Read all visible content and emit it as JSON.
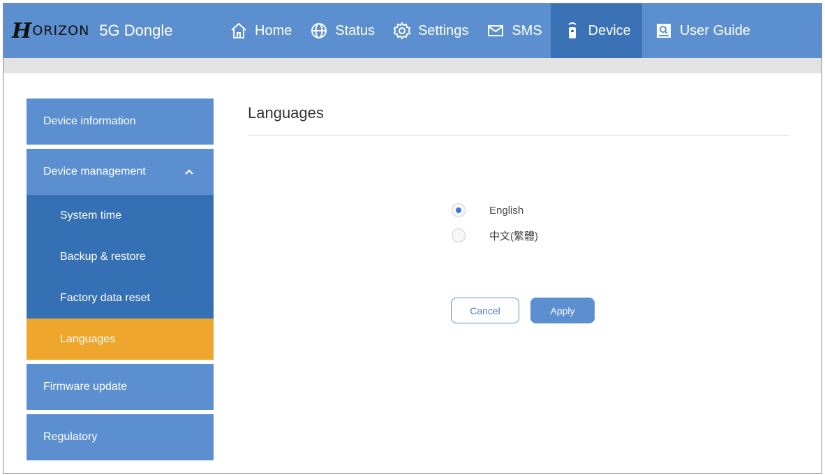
{
  "brand": {
    "logo": "H",
    "name": "ORIZON",
    "product": "5G Dongle"
  },
  "nav": [
    {
      "label": "Home",
      "icon": "home-icon"
    },
    {
      "label": "Status",
      "icon": "globe-icon"
    },
    {
      "label": "Settings",
      "icon": "gear-icon"
    },
    {
      "label": "SMS",
      "icon": "envelope-icon"
    },
    {
      "label": "Device",
      "icon": "device-icon",
      "active": true
    },
    {
      "label": "User Guide",
      "icon": "guide-icon"
    }
  ],
  "sidebar": {
    "device_information": "Device information",
    "device_management": "Device management",
    "sub": [
      "System time",
      "Backup & restore",
      "Factory data reset",
      "Languages"
    ],
    "firmware_update": "Firmware update",
    "regulatory": "Regulatory"
  },
  "page": {
    "title": "Languages",
    "options": [
      "English",
      "中文(繁體)"
    ],
    "selected": "English",
    "cancel": "Cancel",
    "apply": "Apply"
  },
  "colors": {
    "header": "#5b8fd0",
    "nav_active": "#3b72b6",
    "sidebar_sub": "#3670b4",
    "sidebar_active": "#eea62c",
    "radio_selected": "#3a7ad3"
  }
}
